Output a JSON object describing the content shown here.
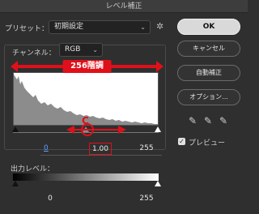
{
  "window": {
    "title": "レベル補正"
  },
  "preset": {
    "label": "プリセット：",
    "value": "初期設定"
  },
  "channel": {
    "label": "チャンネル：",
    "value": "RGB"
  },
  "annotation": {
    "banner": "256階調",
    "marker": "C"
  },
  "input_levels": {
    "black": "0",
    "gamma": "1.00",
    "white": "255"
  },
  "output": {
    "label": "出力レベル：",
    "black": "0",
    "white": "255"
  },
  "buttons": {
    "ok": "OK",
    "cancel": "キャンセル",
    "auto": "自動補正",
    "options": "オプション..."
  },
  "preview": {
    "label": "プレビュー",
    "checked": true
  },
  "colors": {
    "accent_red": "#e0101a",
    "panel_bg": "#2f2f2f"
  }
}
